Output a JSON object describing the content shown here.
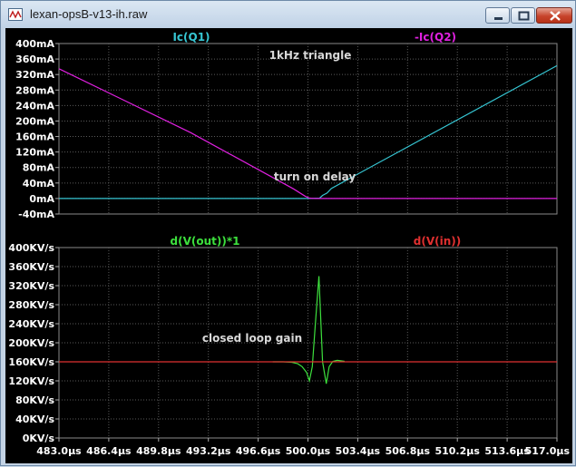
{
  "window": {
    "title": "lexan-opsB-v13-ih.raw",
    "icons": [
      "waveform-app-icon",
      "minimize-icon",
      "maximize-icon",
      "close-icon"
    ]
  },
  "colors": {
    "background": "#000000",
    "grid": "#5a5a5a",
    "axis_text": "#ffffff",
    "ic_q1": "#36c6d3",
    "ic_q2": "#e020e0",
    "dv_out": "#3de03d",
    "dv_in": "#e03030",
    "annotation": "#d8d8d8"
  },
  "chart_data": [
    {
      "type": "line",
      "title": "",
      "xlabel": "",
      "ylabel": "",
      "grid": true,
      "xlim": [
        483.0,
        517.0
      ],
      "ylim": [
        -40,
        400
      ],
      "yticks": [
        "400mA",
        "360mA",
        "320mA",
        "280mA",
        "240mA",
        "200mA",
        "160mA",
        "120mA",
        "80mA",
        "40mA",
        "0mA",
        "-40mA"
      ],
      "annotations": [
        "1kHz triangle",
        "turn on delay"
      ],
      "series": [
        {
          "name": "Ic(Q1)",
          "color": "#36c6d3",
          "x": [
            483.0,
            500.0,
            500.8,
            501.0,
            501.3,
            501.6,
            517.0
          ],
          "y": [
            0,
            0,
            1,
            8,
            14,
            26,
            343
          ]
        },
        {
          "name": "-Ic(Q2)",
          "color": "#e020e0",
          "x": [
            483.0,
            492.0,
            499.0,
            499.8,
            500.1,
            500.5,
            517.0
          ],
          "y": [
            335,
            170,
            25,
            6,
            1,
            0,
            0
          ]
        }
      ]
    },
    {
      "type": "line",
      "title": "",
      "xlabel": "",
      "ylabel": "",
      "grid": true,
      "xlim": [
        483.0,
        517.0
      ],
      "ylim": [
        0,
        400
      ],
      "xticks": [
        "483.0µs",
        "486.4µs",
        "489.8µs",
        "493.2µs",
        "496.6µs",
        "500.0µs",
        "503.4µs",
        "506.8µs",
        "510.2µs",
        "513.6µs",
        "517.0µs"
      ],
      "yticks": [
        "400KV/s",
        "360KV/s",
        "320KV/s",
        "280KV/s",
        "240KV/s",
        "200KV/s",
        "160KV/s",
        "120KV/s",
        "80KV/s",
        "40KV/s",
        "0KV/s"
      ],
      "annotations": [
        "closed loop gain"
      ],
      "series": [
        {
          "name": "d(V(out))*1",
          "color": "#3de03d",
          "x": [
            497.6,
            498.3,
            498.9,
            499.3,
            499.6,
            499.9,
            500.1,
            500.3,
            500.5,
            500.75,
            501.0,
            501.25,
            501.45,
            501.7,
            502.0,
            502.5
          ],
          "y": [
            160,
            160,
            159,
            156,
            150,
            138,
            120,
            150,
            238,
            340,
            160,
            114,
            150,
            161,
            163,
            161
          ]
        },
        {
          "name": "d(V(in))",
          "color": "#e03030",
          "x": [
            483.0,
            517.0
          ],
          "y": [
            160,
            160
          ]
        }
      ]
    }
  ]
}
